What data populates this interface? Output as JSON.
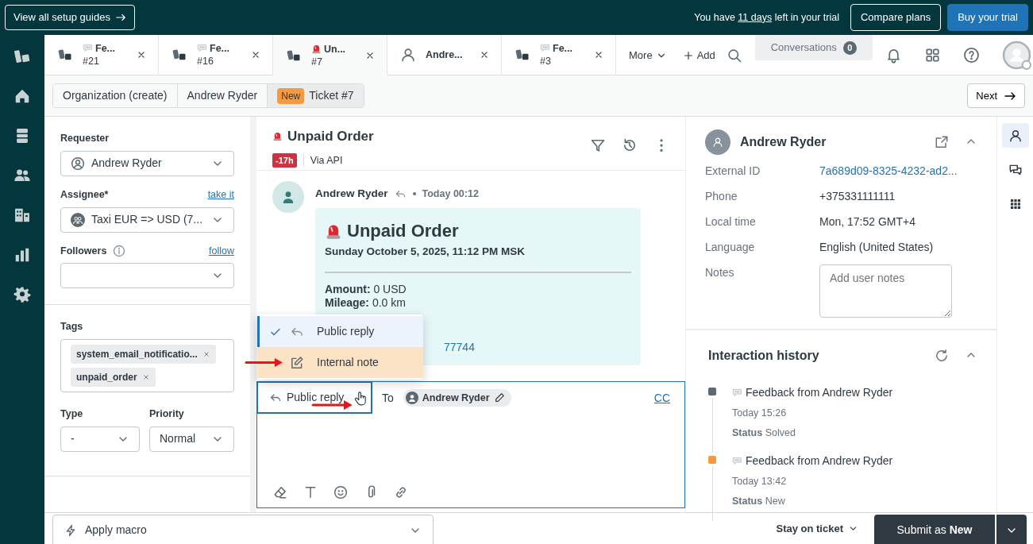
{
  "trial_bar": {
    "guides_button": "View all setup guides",
    "trial_prefix": "You have",
    "trial_days": "11 days",
    "trial_suffix": "left in your trial",
    "compare_button": "Compare plans",
    "buy_button": "Buy your trial"
  },
  "tabs": [
    {
      "kind": "feedback",
      "title": "Fe...",
      "number": "#21",
      "selected": false
    },
    {
      "kind": "feedback",
      "title": "Fe...",
      "number": "#16",
      "selected": false
    },
    {
      "kind": "alert",
      "title": "Un...",
      "number": "#7",
      "selected": true
    },
    {
      "kind": "user",
      "title": "Andre...",
      "selected": false
    },
    {
      "kind": "feedback",
      "title": "Fe...",
      "number": "#3",
      "selected": false
    }
  ],
  "toolbar": {
    "more": "More",
    "add": "Add",
    "conversations": "Conversations",
    "conversations_count": "0"
  },
  "breadcrumbs": [
    {
      "label": "Organization (create)",
      "selected": false
    },
    {
      "label": "Andrew Ryder",
      "selected": false
    },
    {
      "status": "New",
      "label": "Ticket #7",
      "selected": true
    }
  ],
  "next_button": "Next",
  "properties": {
    "requester_label": "Requester",
    "requester_value": "Andrew Ryder",
    "assignee_label": "Assignee*",
    "take_it": "take it",
    "assignee_value": "Taxi EUR => USD (7...",
    "followers_label": "Followers",
    "follow_link": "follow",
    "tags_label": "Tags",
    "tags": [
      "system_email_notificatio...",
      "unpaid_order"
    ],
    "type_label": "Type",
    "type_value": "-",
    "priority_label": "Priority",
    "priority_value": "Normal"
  },
  "ticket": {
    "title": "Unpaid Order",
    "sla": "-17h",
    "channel": "Via API"
  },
  "message": {
    "author": "Andrew Ryder",
    "time": "Today 00:12",
    "heading": "Unpaid Order",
    "date": "Sunday October 5, 2025, 11:12 PM MSK",
    "lines": [
      "**Amount:** 0 USD",
      "**Mileage:** 0.0 km"
    ],
    "link_fragment": "77744"
  },
  "reply_menu": [
    {
      "kind": "public",
      "label": "Public reply",
      "selected": true,
      "hovered": false
    },
    {
      "kind": "internal",
      "label": "Internal note",
      "selected": false,
      "hovered": true
    }
  ],
  "composer": {
    "mode": "Public reply",
    "to_label": "To",
    "recipient": "Andrew Ryder",
    "cc": "CC"
  },
  "bottom": {
    "macro": "Apply macro",
    "stay": "Stay on ticket",
    "submit": "Submit as **New**"
  },
  "user": {
    "name": "Andrew Ryder",
    "fields": [
      {
        "label": "External ID",
        "value": "7a689d09-8325-4232-ad2...",
        "kind": "link"
      },
      {
        "label": "Phone",
        "value": "+375331111111",
        "kind": "text"
      },
      {
        "label": "Local time",
        "value": "Mon, 17:52 GMT+4",
        "kind": "text"
      },
      {
        "label": "Language",
        "value": "English (United States)",
        "kind": "text"
      }
    ],
    "notes_label": "Notes",
    "notes_placeholder": "Add user notes"
  },
  "history": {
    "title": "Interaction history",
    "items": [
      {
        "title": "Feedback from Andrew Ryder",
        "time": "Today 15:26",
        "status": "**Status** Solved",
        "color": "#5c6970"
      },
      {
        "title": "Feedback from Andrew Ryder",
        "time": "Today 13:42",
        "status": "**Status** New",
        "color": "#f79a3e"
      }
    ]
  },
  "rail": [
    {
      "kind": "user",
      "selected": true
    },
    {
      "kind": "chat",
      "selected": false
    },
    {
      "kind": "apps",
      "selected": false
    }
  ]
}
